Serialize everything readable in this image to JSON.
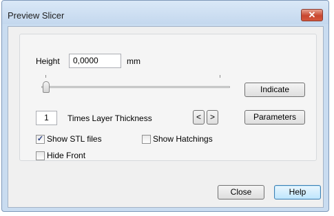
{
  "window": {
    "title": "Preview Slicer",
    "close_glyph": "✕"
  },
  "height": {
    "label": "Height",
    "value": "0,0000",
    "unit": "mm"
  },
  "indicate_label": "Indicate",
  "layers": {
    "value": "1",
    "label": "Times Layer Thickness",
    "prev": "<",
    "next": ">"
  },
  "parameters_label": "Parameters",
  "options": {
    "show_stl": {
      "label": "Show STL files",
      "checked": true,
      "mark": "✓"
    },
    "show_hatchings": {
      "label": "Show Hatchings",
      "checked": false
    },
    "hide_front": {
      "label": "Hide Front",
      "checked": false
    }
  },
  "footer": {
    "close_label": "Close",
    "help_label": "Help"
  },
  "colors": {
    "titlebar": "#c4d8ee",
    "close_button": "#c8462f",
    "default_button": "#bee6fd"
  }
}
